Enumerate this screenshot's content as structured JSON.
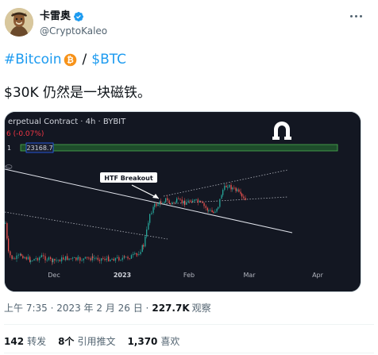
{
  "author": {
    "display_name": "卡雷奥",
    "handle": "@CryptoKaleo",
    "verified_icon": "verified-badge-icon",
    "avatar_icon": "avatar-image"
  },
  "tweet": {
    "hashtag": "#Bitcoin",
    "btc_emoji": "bitcoin-emoji-icon",
    "slash": "/",
    "cashtag": "$BTC",
    "text": "$30K 仍然是一块磁铁。"
  },
  "chart": {
    "title": "erpetual Contract · 4h · BYBIT",
    "change": "6 (-0.07%)",
    "price_label": "23168.7",
    "row_marker": "1",
    "callout": "HTF Breakout",
    "logo": "magnet-logo-icon",
    "x_ticks": [
      "Dec",
      "2023",
      "Feb",
      "Mar",
      "Apr"
    ],
    "colors": {
      "background": "#131722",
      "candle_up": "#26a69a",
      "candle_down": "#ef5350",
      "zone": "#1e4d2b",
      "zone_border": "#4caf50"
    }
  },
  "meta": {
    "time": "上午 7:35 · 2023 年 2 月 26 日 ·",
    "views_count": "227.7K",
    "views_label": "观察"
  },
  "stats": {
    "retweets_count": "142",
    "retweets_label": "转发",
    "quotes_count": "8个",
    "quotes_label": "引用推文",
    "likes_count": "1,370",
    "likes_label": "喜欢"
  }
}
